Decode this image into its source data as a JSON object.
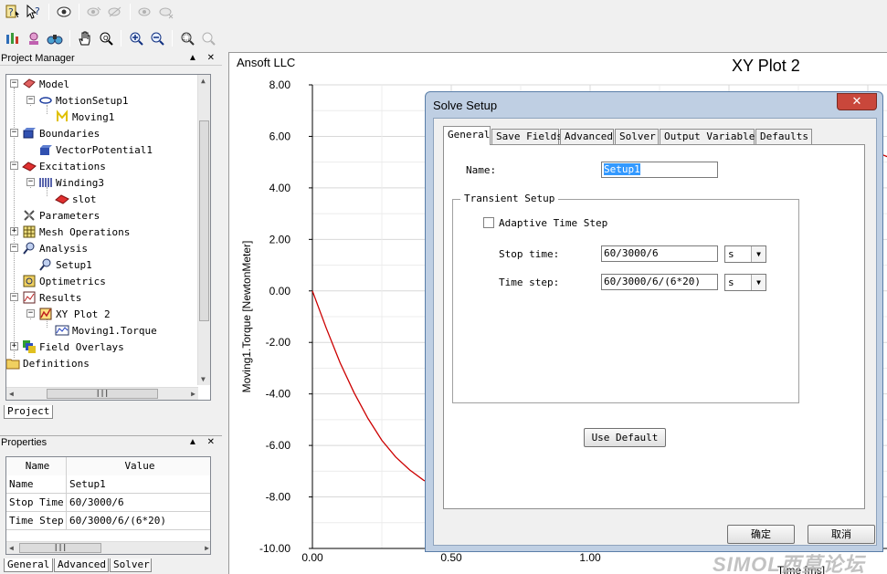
{
  "toolbar1": {
    "buttons": [
      "context-help-icon",
      "whats-this-help-icon",
      "eye-visibility-icon",
      "show-all-icon",
      "hide-all-icon",
      "show-selection-icon",
      "hide-selection-icon"
    ]
  },
  "toolbar2": {
    "buttons": [
      "bar-chart-icon",
      "user-icon",
      "binoculars-icon",
      "hand-pan-icon",
      "zoom-query-icon",
      "zoom-in-icon",
      "zoom-out-icon",
      "zoom-fit-icon",
      "zoom-area-icon"
    ]
  },
  "project_manager": {
    "title": "Project Manager",
    "header_controls": "▲ ✕",
    "tree": [
      {
        "label": "Model",
        "icon": "model-icon"
      },
      {
        "label": "MotionSetup1",
        "icon": "motion-setup-icon"
      },
      {
        "label": "Moving1",
        "icon": "moving-icon"
      },
      {
        "label": "Boundaries",
        "icon": "boundaries-icon"
      },
      {
        "label": "VectorPotential1",
        "icon": "vector-potential-icon"
      },
      {
        "label": "Excitations",
        "icon": "excitations-icon"
      },
      {
        "label": "Winding3",
        "icon": "winding-icon"
      },
      {
        "label": "slot",
        "icon": "slot-icon"
      },
      {
        "label": "Parameters",
        "icon": "parameters-icon"
      },
      {
        "label": "Mesh Operations",
        "icon": "mesh-operations-icon"
      },
      {
        "label": "Analysis",
        "icon": "analysis-icon"
      },
      {
        "label": "Setup1",
        "icon": "setup-icon"
      },
      {
        "label": "Optimetrics",
        "icon": "optimetrics-icon"
      },
      {
        "label": "Results",
        "icon": "results-icon"
      },
      {
        "label": "XY Plot 2",
        "icon": "xy-plot-icon"
      },
      {
        "label": "Moving1.Torque",
        "icon": "trace-icon"
      },
      {
        "label": "Field Overlays",
        "icon": "field-overlays-icon"
      },
      {
        "label": "Definitions",
        "icon": "folder-icon"
      }
    ],
    "tab": "Project"
  },
  "properties": {
    "title": "Properties",
    "header_controls": "▲ ✕",
    "columns": [
      "Name",
      "Value"
    ],
    "rows": [
      [
        "Name",
        "Setup1"
      ],
      [
        "Stop Time",
        "60/3000/6"
      ],
      [
        "Time Step",
        "60/3000/6/(6*20)"
      ]
    ],
    "tabs": [
      "General",
      "Advanced",
      "Solver"
    ]
  },
  "plot": {
    "company": "Ansoft LLC",
    "title": "XY Plot 2",
    "watermark": "SIMOL西莫论坛"
  },
  "chart_data": {
    "type": "line",
    "title": "XY Plot 2",
    "xlabel": "Time [ms]",
    "ylabel": "Moving1.Torque [NewtonMeter]",
    "xlim": [
      0,
      2.0
    ],
    "ylim": [
      -10,
      8
    ],
    "x_ticks": [
      "0.00",
      "0.50",
      "1.00"
    ],
    "y_ticks": [
      "8.00",
      "6.00",
      "4.00",
      "2.00",
      "0.00",
      "-2.00",
      "-4.00",
      "-6.00",
      "-8.00",
      "-10.00"
    ],
    "grid": true,
    "series": [
      {
        "color": "#cc0000",
        "x": [
          0.0,
          0.05,
          0.1,
          0.15,
          0.2,
          0.25,
          0.3,
          0.35,
          0.4,
          0.45
        ],
        "y": [
          0.0,
          -1.45,
          -2.8,
          -3.95,
          -4.95,
          -5.8,
          -6.45,
          -6.95,
          -7.35,
          -7.6
        ]
      }
    ]
  },
  "dialog": {
    "title": "Solve Setup",
    "close": "✕",
    "tabs": [
      "General",
      "Save Fields",
      "Advanced",
      "Solver",
      "Output Variables",
      "Defaults"
    ],
    "name_label": "Name:",
    "name_value": "Setup1",
    "group_title": "Transient Setup",
    "adaptive_label": "Adaptive Time Step",
    "adaptive_checked": false,
    "stop_time_label": "Stop time:",
    "stop_time_value": "60/3000/6",
    "stop_time_unit": "s",
    "time_step_label": "Time step:",
    "time_step_value": "60/3000/6/(6*20)",
    "time_step_unit": "s",
    "use_default": "Use Default",
    "ok": "确定",
    "cancel": "取消"
  }
}
